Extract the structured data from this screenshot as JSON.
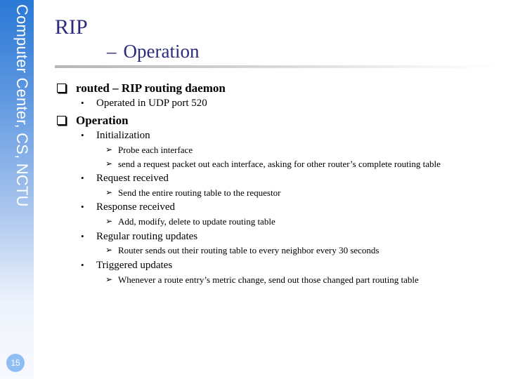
{
  "sidebar": {
    "org_text": "Computer Center, CS, NCTU",
    "page_number": "15"
  },
  "title": {
    "main": "RIP",
    "sub_dash": "–",
    "sub": "Operation"
  },
  "bullets": {
    "routed": {
      "label": "routed – RIP routing daemon",
      "sub": [
        "Operated in UDP port 520"
      ]
    },
    "operation": {
      "label": "Operation",
      "items": [
        {
          "label": "Initialization",
          "sub": [
            "Probe each interface",
            "send a request packet out each interface, asking for other router’s complete routing table"
          ]
        },
        {
          "label": "Request received",
          "sub": [
            "Send the entire routing table to the requestor"
          ]
        },
        {
          "label": "Response received",
          "sub": [
            "Add, modify, delete to update routing table"
          ]
        },
        {
          "label": "Regular routing updates",
          "sub": [
            "Router sends out their routing table to every neighbor every 30 seconds"
          ]
        },
        {
          "label": "Triggered updates",
          "sub": [
            "Whenever a route entry’s metric change, send out those changed part routing table"
          ]
        }
      ]
    }
  },
  "glyphs": {
    "l2_bullet": "•",
    "l3_bullet": "➢"
  }
}
